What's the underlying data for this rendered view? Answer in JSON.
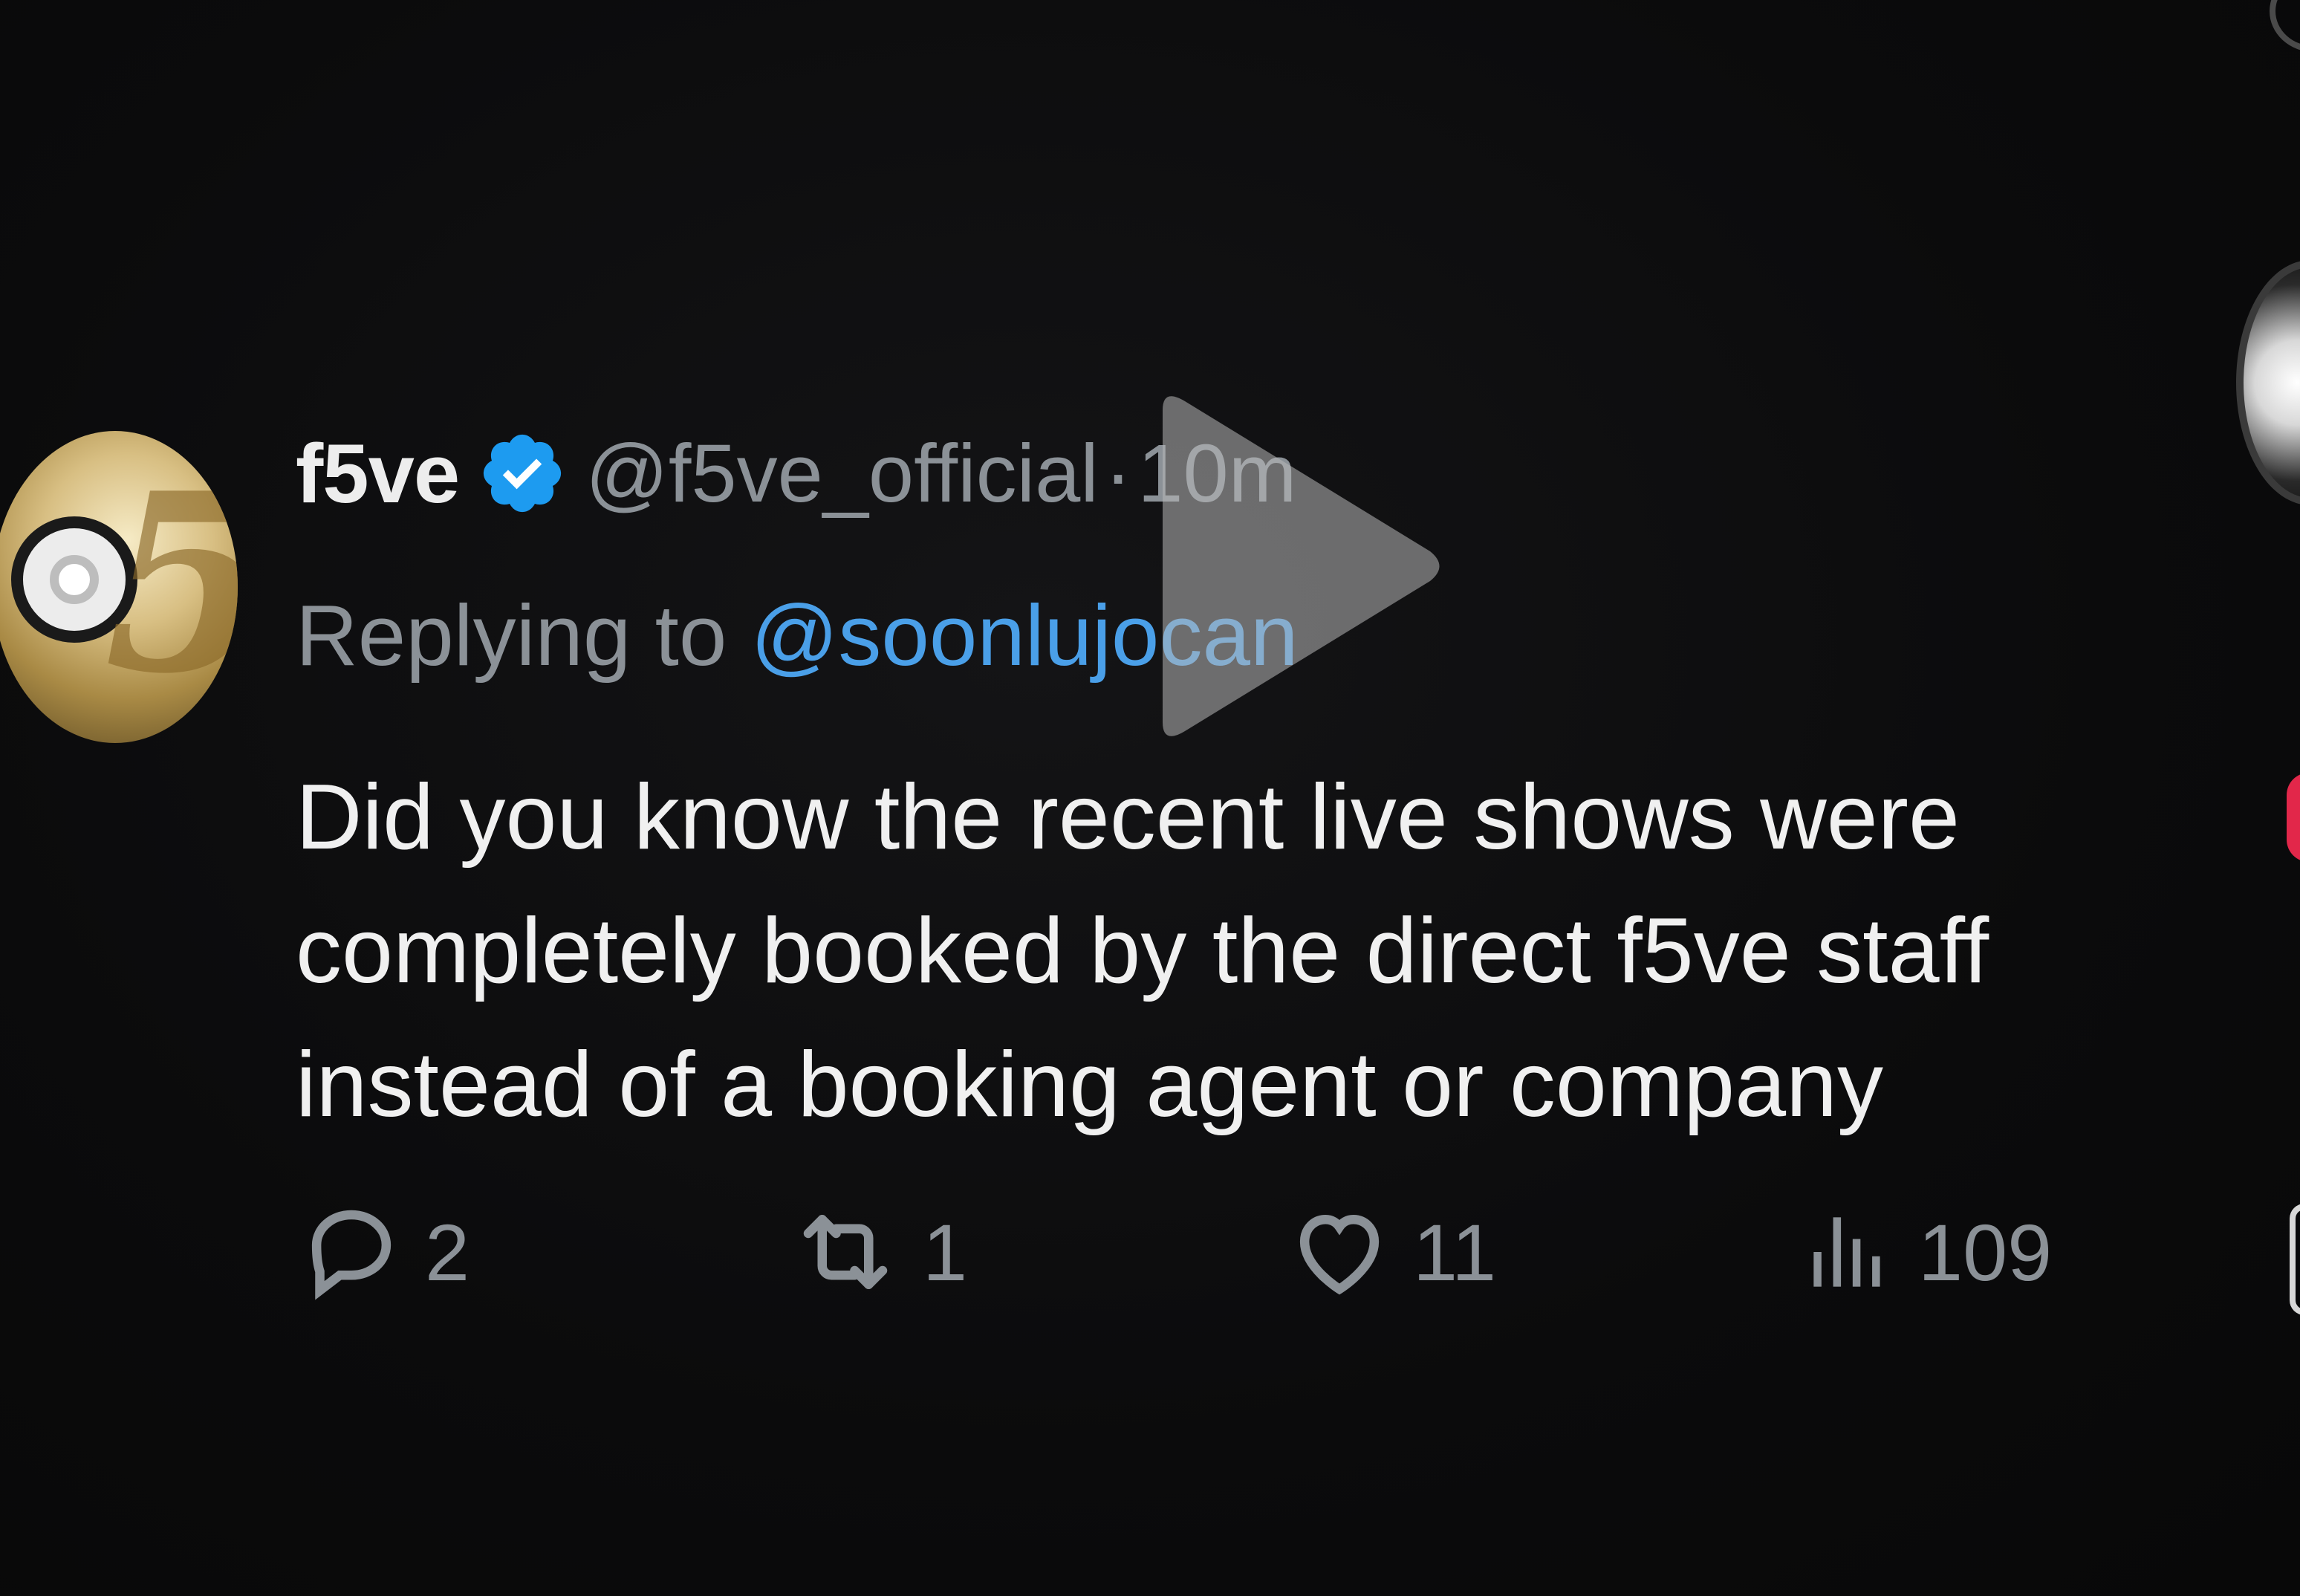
{
  "tweet": {
    "display_name": "f5ve",
    "verified_icon": "verified-badge-icon",
    "handle": "@f5ve_official",
    "separator": "·",
    "time": "10m",
    "replying_prefix": "Replying to ",
    "replying_to": "@soonlujocan",
    "body_lines": [
      "Did you know the recent live shows were",
      "completely booked by the direct f5ve staff",
      "instead of a booking agent or company"
    ]
  },
  "actions": {
    "reply": {
      "icon": "reply-bubble-icon",
      "count": "2"
    },
    "retweet": {
      "icon": "retweet-icon",
      "count": "1"
    },
    "like": {
      "icon": "heart-icon",
      "count": "11"
    },
    "views": {
      "icon": "views-bars-icon",
      "count": "109"
    }
  },
  "overlay": {
    "play_icon": "play-icon"
  },
  "colors": {
    "background": "#0c0c0d",
    "text_primary": "#f0f0f0",
    "text_secondary": "#8b9197",
    "mention": "#4a9fe8",
    "verified": "#1d9bf0"
  }
}
